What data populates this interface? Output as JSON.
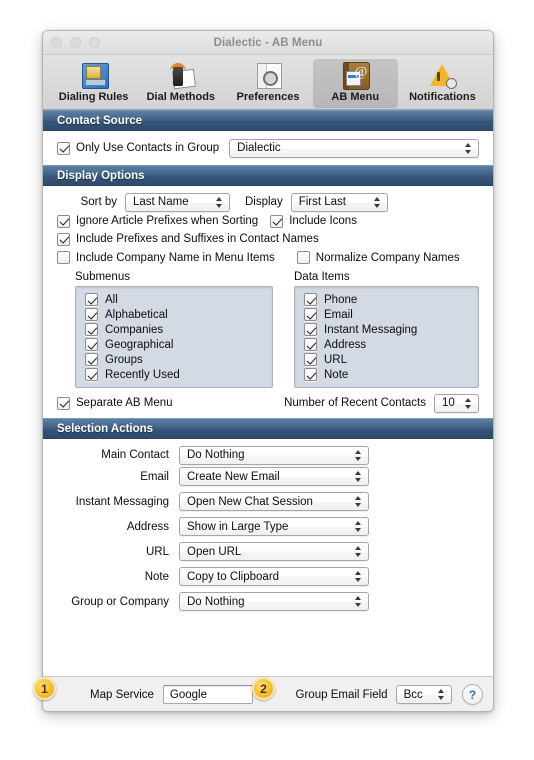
{
  "window": {
    "title": "Dialectic - AB Menu",
    "traffic_lights": [
      "close-button",
      "minimize-button",
      "zoom-button"
    ]
  },
  "toolbar": {
    "items": [
      {
        "label": "Dialing Rules",
        "icon": "dialing-rules-icon",
        "selected": false
      },
      {
        "label": "Dial Methods",
        "icon": "dial-methods-icon",
        "selected": false
      },
      {
        "label": "Preferences",
        "icon": "preferences-icon",
        "selected": false
      },
      {
        "label": "AB Menu",
        "icon": "ab-menu-icon",
        "selected": true
      },
      {
        "label": "Notifications",
        "icon": "notifications-icon",
        "selected": false
      }
    ]
  },
  "contact_source": {
    "header": "Contact Source",
    "only_use_group": {
      "label": "Only Use Contacts in Group",
      "checked": true
    },
    "group_popup": {
      "value": "Dialectic"
    }
  },
  "display_options": {
    "header": "Display Options",
    "sort_by_label": "Sort by",
    "sort_by_value": "Last Name",
    "display_label": "Display",
    "display_value": "First Last",
    "checkboxes": [
      {
        "label": "Ignore Article Prefixes when Sorting",
        "checked": true
      },
      {
        "label": "Include Icons",
        "checked": true
      },
      {
        "label": "Include Prefixes and Suffixes in Contact Names",
        "checked": true
      },
      {
        "label": "Include Company Name in Menu Items",
        "checked": false
      },
      {
        "label": "Normalize Company Names",
        "checked": false
      }
    ],
    "submenus": {
      "title": "Submenus",
      "items": [
        {
          "label": "All",
          "checked": true
        },
        {
          "label": "Alphabetical",
          "checked": true
        },
        {
          "label": "Companies",
          "checked": true
        },
        {
          "label": "Geographical",
          "checked": true
        },
        {
          "label": "Groups",
          "checked": true
        },
        {
          "label": "Recently Used",
          "checked": true
        }
      ]
    },
    "data_items": {
      "title": "Data Items",
      "items": [
        {
          "label": "Phone",
          "checked": true
        },
        {
          "label": "Email",
          "checked": true
        },
        {
          "label": "Instant Messaging",
          "checked": true
        },
        {
          "label": "Address",
          "checked": true
        },
        {
          "label": "URL",
          "checked": true
        },
        {
          "label": "Note",
          "checked": true
        }
      ]
    },
    "separate_ab_menu": {
      "label": "Separate AB Menu",
      "checked": true
    },
    "recent_contacts_label": "Number of Recent Contacts",
    "recent_contacts_value": "10"
  },
  "selection_actions": {
    "header": "Selection Actions",
    "rows": [
      {
        "label": "Main Contact",
        "value": "Do Nothing"
      },
      {
        "label": "Email",
        "value": "Create New Email"
      },
      {
        "label": "Instant Messaging",
        "value": "Open New Chat Session"
      },
      {
        "label": "Address",
        "value": "Show in Large Type"
      },
      {
        "label": "URL",
        "value": "Open URL"
      },
      {
        "label": "Note",
        "value": "Copy to Clipboard"
      },
      {
        "label": "Group or Company",
        "value": "Do Nothing"
      }
    ]
  },
  "bottom_bar": {
    "map_service_label": "Map Service",
    "map_service_value": "Google",
    "group_email_label": "Group Email Field",
    "group_email_value": "Bcc",
    "help_glyph": "?"
  },
  "callouts": [
    {
      "number": "1"
    },
    {
      "number": "2"
    }
  ],
  "colors": {
    "section_header_blue": "#406185",
    "listbox_bg": "#d3dae3",
    "badge_yellow": "#f8c33b",
    "help_blue": "#2f6fc0"
  }
}
